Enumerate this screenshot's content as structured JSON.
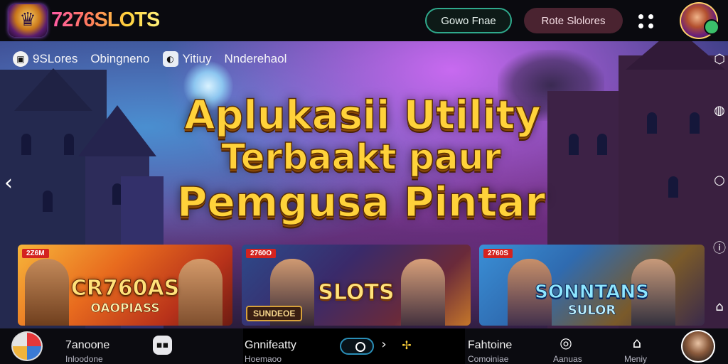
{
  "topbar": {
    "logo_text": "7276SLOTS",
    "btn_outline_label": "Gowo Fnae",
    "btn_fill_label": "Rote Slolores"
  },
  "hero": {
    "categories": [
      {
        "icon": "square-badge-icon",
        "label": "9SLores"
      },
      {
        "icon": "",
        "label": "Obingneno"
      },
      {
        "icon": "image-icon",
        "label": "Yitiuy"
      },
      {
        "icon": "",
        "label": "Nnderehaol"
      }
    ],
    "headline": [
      "Aplukasii Utility",
      "Terbaakt paur",
      "Pemgusa Pintar"
    ]
  },
  "cards": [
    {
      "tag": "2Z6M",
      "title": "CR760AS",
      "subtitle": "OAOPIASS"
    },
    {
      "tag": "2760O",
      "title": "SLOTS",
      "badge": "SUNDEOE"
    },
    {
      "tag": "2760S",
      "title": "SONNTANS",
      "subtitle": "SULOR"
    }
  ],
  "bottombar": {
    "item1_title": "7anoone",
    "item1_sub": "Inloodone",
    "item2_title": "Gnnifeatty",
    "item2_sub": "Hoemaoo",
    "item3_title": "Fahtoine",
    "item3_sub": "Comoiniae",
    "item4_sub": "Aanuas",
    "item5_sub": "Meniy"
  },
  "colors": {
    "accent_gold": "#ffd23a",
    "outline_button": "#2fa98c",
    "fill_button": "#4a2330"
  }
}
